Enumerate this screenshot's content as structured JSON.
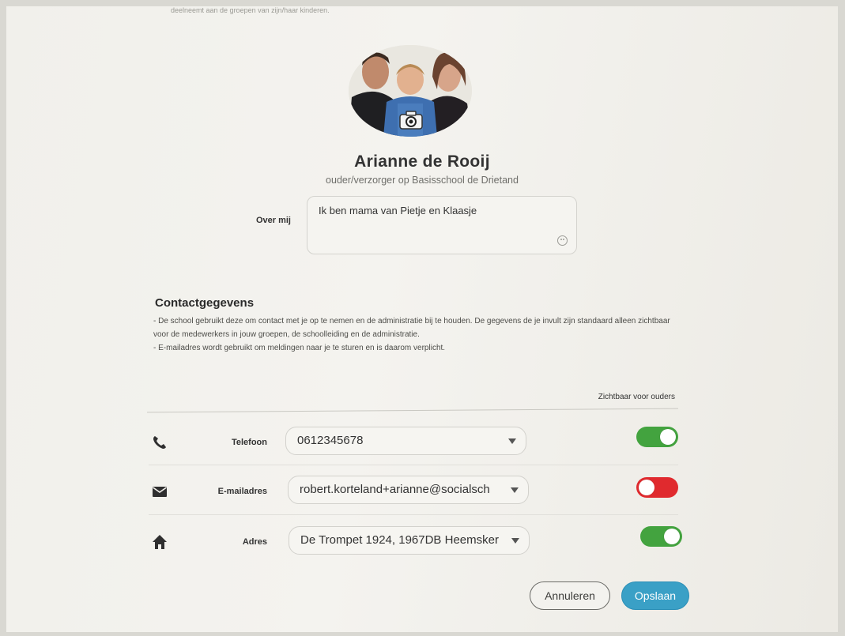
{
  "header": {
    "truncated_note": "deelneemt aan de groepen van zijn/haar kinderen."
  },
  "profile": {
    "name": "Arianne de Rooij",
    "role": "ouder/verzorger op Basisschool de Drietand",
    "about_label": "Over mij",
    "about_text": "Ik ben mama van Pietje en Klaasje"
  },
  "contact": {
    "title": "Contactgegevens",
    "info_line1": "- De school gebruikt deze om contact met je op te nemen en de administratie bij te houden. De gegevens de je invult zijn standaard alleen zichtbaar voor de medewerkers in jouw groepen, de schoolleiding en de administratie.",
    "info_line2": "- E-mailadres wordt gebruikt om meldingen naar je te sturen en is daarom verplicht.",
    "visible_header": "Zichtbaar voor ouders",
    "rows": [
      {
        "icon": "phone-icon",
        "label": "Telefoon",
        "value": "0612345678",
        "visible_for_parents": true
      },
      {
        "icon": "envelope-icon",
        "label": "E-mailadres",
        "value": "robert.korteland+arianne@socialsch",
        "visible_for_parents": false
      },
      {
        "icon": "home-icon",
        "label": "Adres",
        "value": "De Trompet 1924, 1967DB Heemsker",
        "visible_for_parents": true
      }
    ]
  },
  "actions": {
    "cancel_label": "Annuleren",
    "save_label": "Opslaan"
  },
  "colors": {
    "toggle_on": "#43a33f",
    "toggle_off": "#e02a2e",
    "save_button": "#3aa0c6"
  }
}
